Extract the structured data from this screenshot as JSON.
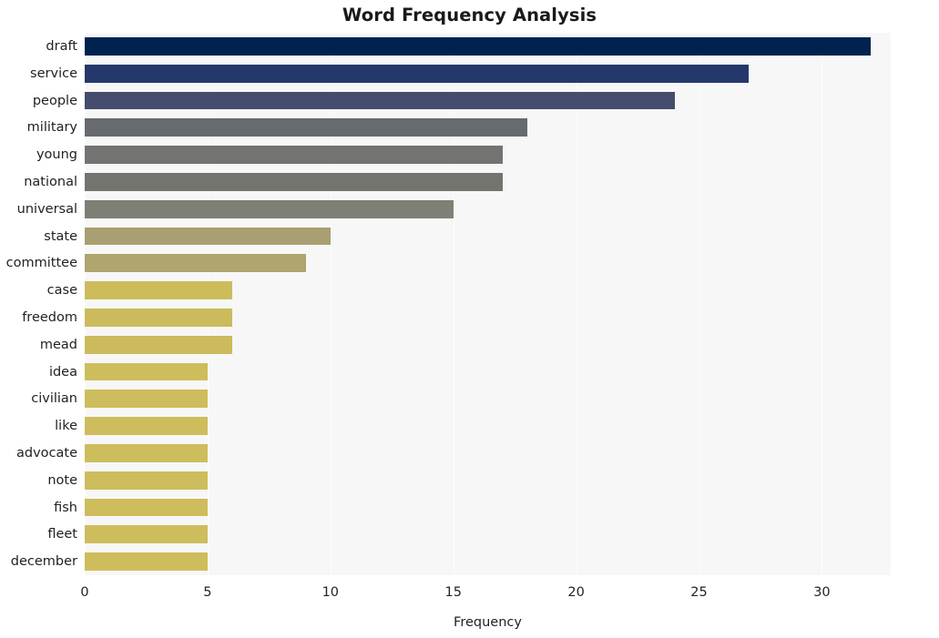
{
  "chart_data": {
    "type": "bar",
    "orientation": "horizontal",
    "title": "Word Frequency Analysis",
    "xlabel": "Frequency",
    "ylabel": "",
    "xlim": [
      0,
      32.8
    ],
    "xticks": [
      0,
      5,
      10,
      15,
      20,
      25,
      30
    ],
    "grid": true,
    "grid_axis": "x",
    "legend": null,
    "categories": [
      "draft",
      "service",
      "people",
      "military",
      "young",
      "national",
      "universal",
      "state",
      "committee",
      "case",
      "freedom",
      "mead",
      "idea",
      "civilian",
      "like",
      "advocate",
      "note",
      "fish",
      "fleet",
      "december"
    ],
    "values": [
      32,
      27,
      24,
      18,
      17,
      17,
      15,
      10,
      9,
      6,
      6,
      6,
      5,
      5,
      5,
      5,
      5,
      5,
      5,
      5
    ],
    "bar_colors": [
      "#00224e",
      "#25386b",
      "#454c6d",
      "#676a6f",
      "#737372",
      "#74746f",
      "#807f76",
      "#a89f72",
      "#b0a46f",
      "#ccbc5c",
      "#cbbb5d",
      "#cbbb5c",
      "#cdbd5c",
      "#cdbd5c",
      "#cdbd5c",
      "#cdbd5c",
      "#cdbd5c",
      "#cdbd5c",
      "#cdbd5c",
      "#cdbd5c"
    ],
    "plot_background": "#f7f7f7",
    "grid_color": "#fcfcfc",
    "text_color": "#222222",
    "title_color": "#1a1a1a"
  }
}
